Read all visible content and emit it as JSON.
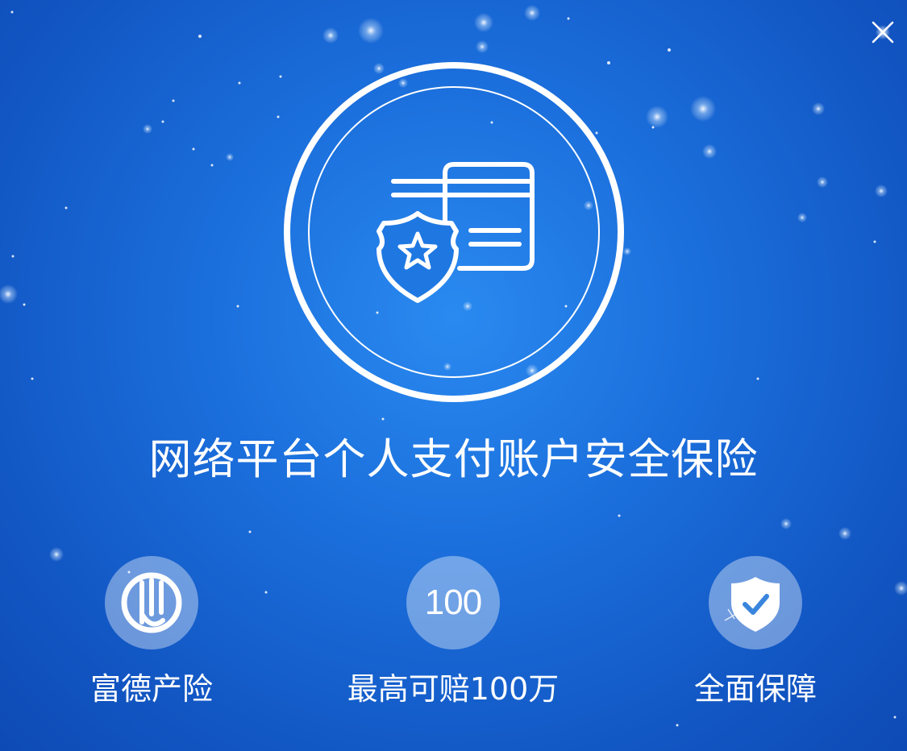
{
  "dialog": {
    "close_icon": "close-icon",
    "hero_icon": "card-shield-icon",
    "headline": "网络平台个人支付账户安全保险"
  },
  "features": [
    {
      "icon": "fude-logo-icon",
      "label": "富德产险"
    },
    {
      "icon": "number-badge",
      "badge_text": "100",
      "label": "最高可赔100万"
    },
    {
      "icon": "shield-check-icon",
      "label": "全面保障"
    }
  ],
  "colors": {
    "background": "#1b6fdc",
    "foreground": "#ffffff",
    "circle_fill": "rgba(255,255,255,0.38)"
  }
}
